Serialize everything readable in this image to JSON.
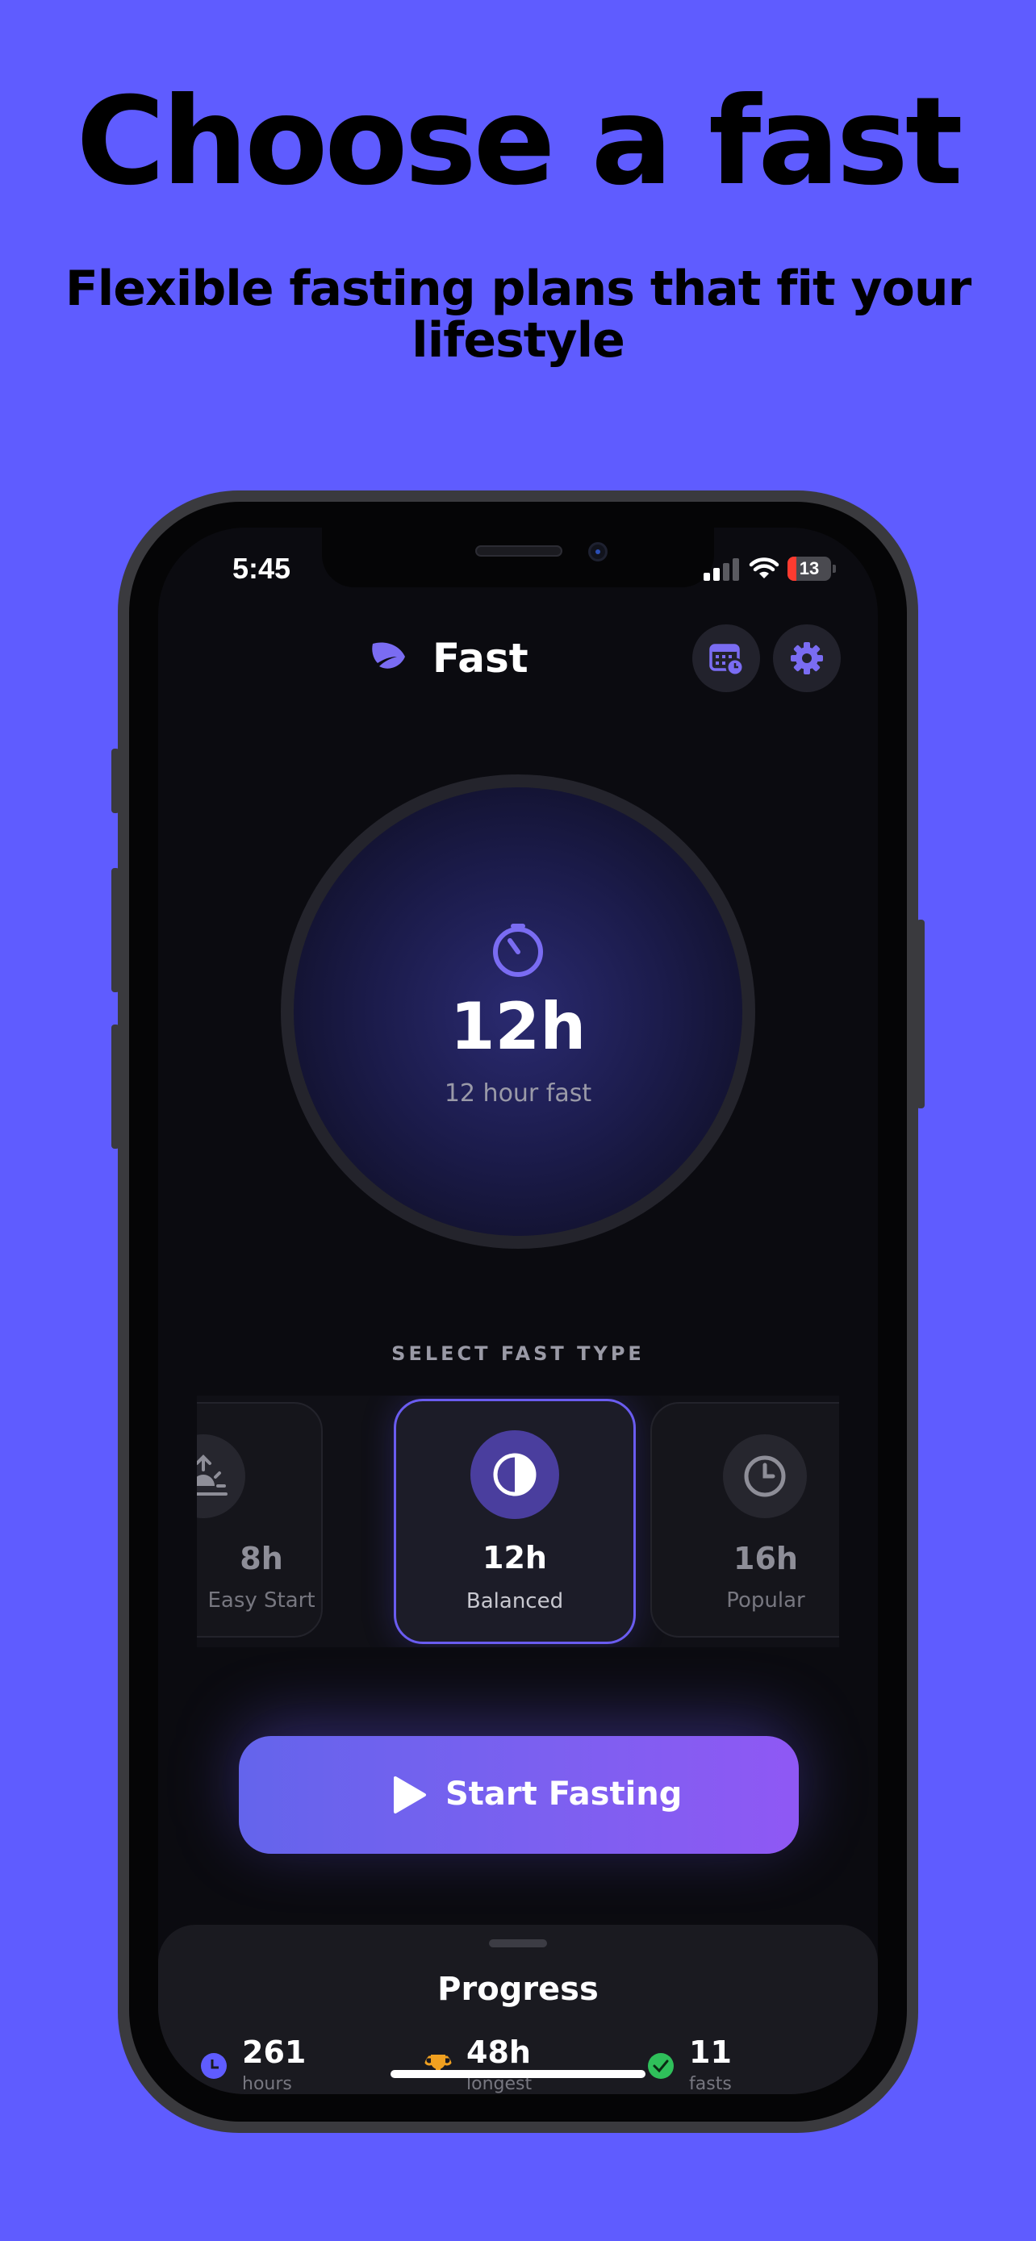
{
  "marketing": {
    "headline": "Choose a fast",
    "subheadline": "Flexible fasting plans that fit your lifestyle"
  },
  "status_bar": {
    "time": "5:45",
    "battery": "13",
    "battery_level": 0.13
  },
  "header": {
    "title": "Fast",
    "icons": [
      "leaf-icon",
      "calendar-clock-icon",
      "gear-icon"
    ]
  },
  "timer": {
    "value": "12h",
    "caption": "12 hour fast",
    "icon": "timer-icon"
  },
  "fast_types": {
    "label": "SELECT FAST TYPE",
    "items": [
      {
        "hours": "8h",
        "name": "Easy Start",
        "icon": "sunrise-icon",
        "selected": false
      },
      {
        "hours": "12h",
        "name": "Balanced",
        "icon": "half-circle-icon",
        "selected": true
      },
      {
        "hours": "16h",
        "name": "Popular",
        "icon": "clock-icon",
        "selected": false
      }
    ]
  },
  "start_button": {
    "label": "Start Fasting",
    "icon": "play-icon"
  },
  "progress": {
    "title": "Progress",
    "stats": [
      {
        "value": "261",
        "label": "hours",
        "icon": "clock-icon",
        "color": "#5f5cff"
      },
      {
        "value": "48h",
        "label": "longest",
        "icon": "trophy-icon",
        "color": "#f0a020"
      },
      {
        "value": "11",
        "label": "fasts",
        "icon": "check-icon",
        "color": "#2fbf5a"
      }
    ]
  },
  "colors": {
    "background": "#5f5cff",
    "accent": "#7c60f0",
    "screen": "#0b0b10"
  }
}
